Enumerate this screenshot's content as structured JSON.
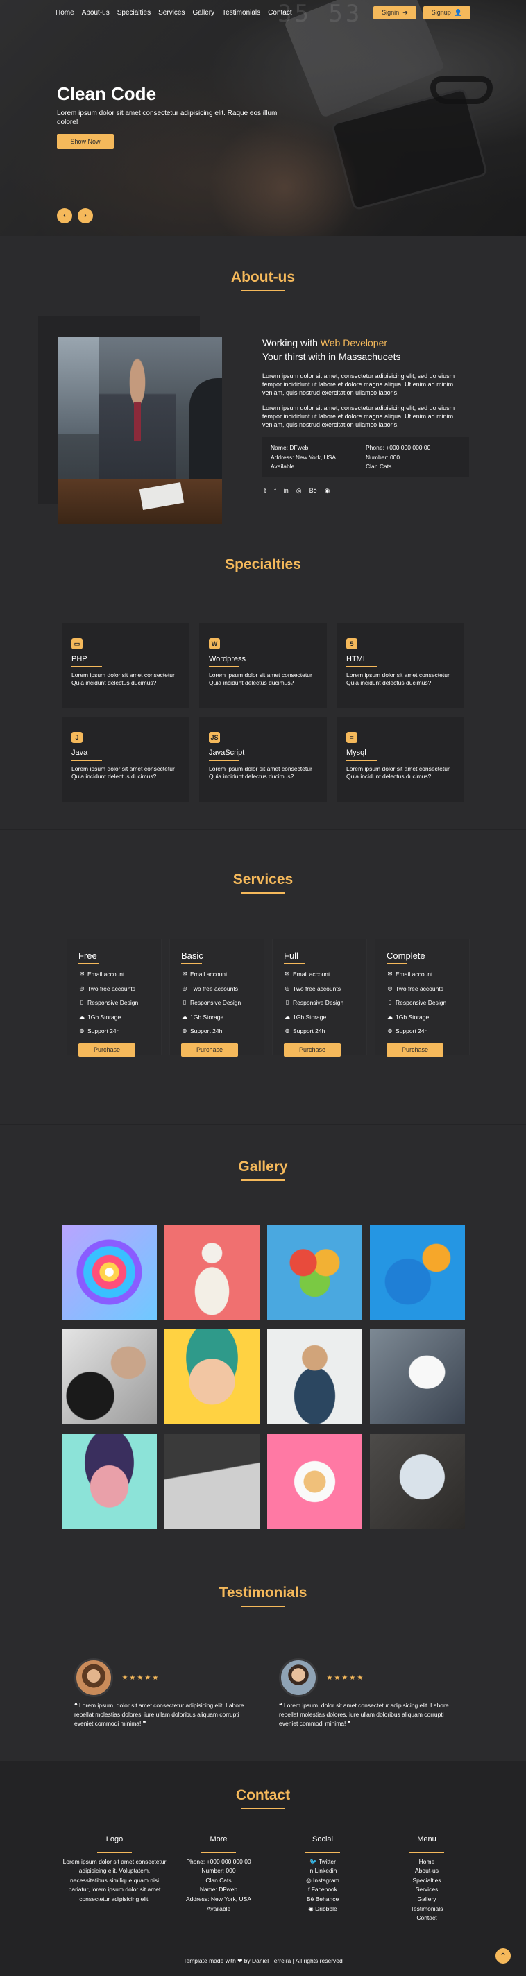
{
  "nav": {
    "links": [
      "Home",
      "About-us",
      "Specialties",
      "Services",
      "Gallery",
      "Testimonials",
      "Contact"
    ],
    "signin": "Signin",
    "signup": "Signup"
  },
  "hero": {
    "title": "Clean Code",
    "text": "Lorem ipsum dolor sit amet consectetur adipisicing elit. Raque eos illum dolore!",
    "button": "Show Now",
    "digits": "35 53"
  },
  "about": {
    "title": "About-us",
    "heading_prefix": "Working with ",
    "heading_highlight": "Web Developer",
    "heading_line2": "Your thirst with in Massachucets",
    "p1": "Lorem ipsum dolor sit amet, consectetur adipisicing elit, sed do eiusm tempor incididunt ut labore et dolore magna aliqua. Ut enim ad minim veniam, quis nostrud exercitation ullamco laboris.",
    "p2": "Lorem ipsum dolor sit amet, consectetur adipisicing elit, sed do eiusm tempor incididunt ut labore et dolore magna aliqua. Ut enim ad minim veniam, quis nostrud exercitation ullamco laboris.",
    "name": "Name: DFweb",
    "address": "Address: New York, USA",
    "available": "Available",
    "phone": "Phone: +000 000 000 00",
    "number": "Number: 000",
    "clan": "Clan Cats",
    "socials": [
      "𝕥",
      "f",
      "in",
      "◎",
      "Bē",
      "◉"
    ]
  },
  "specialties": {
    "title": "Specialties",
    "items": [
      {
        "name": "PHP",
        "icon": "▭",
        "desc": "Lorem ipsum dolor sit amet consectetur Quia incidunt delectus ducimus?"
      },
      {
        "name": "Wordpress",
        "icon": "W",
        "desc": "Lorem ipsum dolor sit amet consectetur Quia incidunt delectus ducimus?"
      },
      {
        "name": "HTML",
        "icon": "5",
        "desc": "Lorem ipsum dolor sit amet consectetur Quia incidunt delectus ducimus?"
      },
      {
        "name": "Java",
        "icon": "J",
        "desc": "Lorem ipsum dolor sit amet consectetur Quia incidunt delectus ducimus?"
      },
      {
        "name": "JavaScript",
        "icon": "JS",
        "desc": "Lorem ipsum dolor sit amet consectetur Quia incidunt delectus ducimus?"
      },
      {
        "name": "Mysql",
        "icon": "≡",
        "desc": "Lorem ipsum dolor sit amet consectetur Quia incidunt delectus ducimus?"
      }
    ]
  },
  "services": {
    "title": "Services",
    "features": [
      "Email account",
      "Two free accounts",
      "Responsive Design",
      "1Gb Storage",
      "Support 24h"
    ],
    "feature_icons": [
      "✉",
      "◎",
      "▯",
      "☁",
      "◍"
    ],
    "plans": [
      "Free",
      "Basic",
      "Full",
      "Complete"
    ],
    "button": "Purchase"
  },
  "gallery": {
    "title": "Gallery"
  },
  "testimonials": {
    "title": "Testimonials",
    "stars": "★★★★★",
    "quote_open": "❝",
    "quote_close": "❞",
    "text": "Lorem ipsum, dolor sit amet consectetur adipisicing elit. Labore repellat molestias dolores, iure ullam doloribus aliquam corrupti eveniet commodi minima!"
  },
  "contact": {
    "title": "Contact",
    "logo_title": "Logo",
    "logo_text": "Lorem ipsum dolor sit amet consectetur adipisicing elit. Voluptatem, necessitatibus similique quam nisi pariatur, lorem ipsum dolor sit amet consectetur adipisicing elit.",
    "more_title": "More",
    "more_items": [
      "Phone: +000 000 000 00",
      "Number: 000",
      "Clan Cats",
      "Name: DFweb",
      "Address: New York, USA",
      "Available"
    ],
    "social_title": "Social",
    "social_items": [
      "Twitter",
      "Linkedin",
      "Instagram",
      "Facebook",
      "Behance",
      "Dribbble"
    ],
    "social_icons": [
      "🐦",
      "in",
      "◎",
      "f",
      "Bē",
      "◉"
    ],
    "menu_title": "Menu",
    "menu_items": [
      "Home",
      "About-us",
      "Specialties",
      "Services",
      "Gallery",
      "Testimonials",
      "Contact"
    ],
    "copy_prefix": "Template made with",
    "heart": "❤",
    "copy_suffix": "by Daniel Ferreira | All rights reserved"
  },
  "colors": {
    "accent": "#f5b95b",
    "bg": "#2b2b2d",
    "card": "#242426"
  }
}
